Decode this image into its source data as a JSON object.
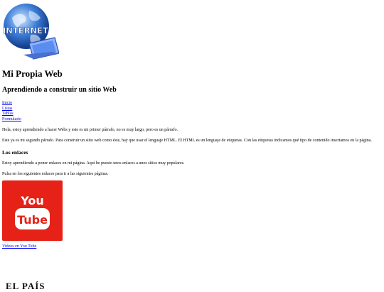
{
  "logo_text": "INTERNET",
  "page_title": "Mi Propia Web",
  "subtitle": "Aprendiendo a construir un sitio Web",
  "nav": {
    "items": [
      "Inicio",
      "Listas",
      "Tablas",
      "Formulario"
    ]
  },
  "paragraphs": {
    "p1": "Hola, estoy aprendiendo a hacer Webs y este es mi primer párrafo, no es muy largo, pero es un párrafo.",
    "p2": "Este ya es mi segundo párrafo. Para construir un sitio web como éste, hay que usar el lenguaje HTML. El HTML es un lenguaje de etiquetas. Con las etiquetas indicamos qué tipo de contenido insertamos en la página."
  },
  "links_section": {
    "heading": "Los enlaces",
    "intro": "Estoy aprendiendo a poner enlaces en mi página. Aquí he puesto unos enlaces a unos sitios muy populares.",
    "prompt": "Pulsa en los siguientes enlaces para ir a las siguientes páginas.",
    "youtube_logo_text": [
      "You",
      "Tube"
    ],
    "youtube_link": "Videos en You Tube",
    "elpais_logo_text": "EL PAÍS"
  },
  "colors": {
    "youtube_red": "#e62117",
    "link": "#0000ee"
  }
}
